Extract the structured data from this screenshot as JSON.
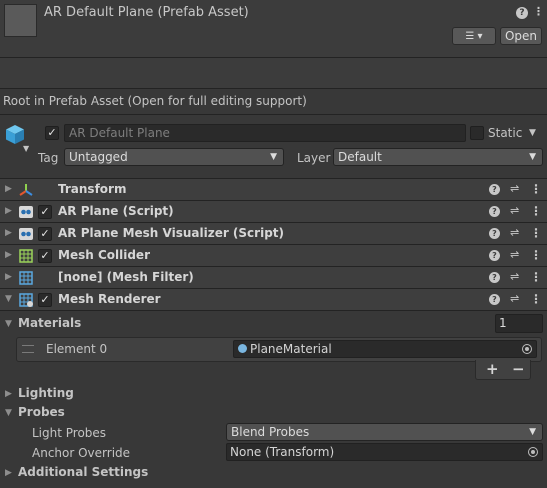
{
  "header": {
    "title": "AR Default Plane (Prefab Asset)",
    "help_icon": "?",
    "menu_icon": "⋮",
    "list_icon": "☰ ▾",
    "open_label": "Open"
  },
  "info_message": "Root in Prefab Asset (Open for full editing support)",
  "gameobject": {
    "active_check": "✓",
    "name": "AR Default Plane",
    "static_label": "Static",
    "tag_label": "Tag",
    "tag_value": "Untagged",
    "layer_label": "Layer",
    "layer_value": "Default"
  },
  "components": [
    {
      "name": "Transform",
      "has_checkbox": false
    },
    {
      "name": "AR Plane (Script)",
      "has_checkbox": true
    },
    {
      "name": "AR Plane Mesh Visualizer (Script)",
      "has_checkbox": true
    },
    {
      "name": "Mesh Collider",
      "has_checkbox": true
    },
    {
      "name": "[none] (Mesh Filter)",
      "has_checkbox": false
    },
    {
      "name": "Mesh Renderer",
      "has_checkbox": true
    }
  ],
  "materials": {
    "label": "Materials",
    "count": "1",
    "element_label": "Element 0",
    "element_value": "PlaneMaterial",
    "add": "+",
    "remove": "−"
  },
  "lighting": {
    "label": "Lighting"
  },
  "probes": {
    "label": "Probes",
    "light_probes_label": "Light Probes",
    "light_probes_value": "Blend Probes",
    "anchor_label": "Anchor Override",
    "anchor_value": "None (Transform)"
  },
  "additional": {
    "label": "Additional Settings"
  },
  "colors": {
    "background": "#383838",
    "header": "#3c3c3c",
    "field": "#2a2a2a",
    "dropdown": "#515151"
  }
}
